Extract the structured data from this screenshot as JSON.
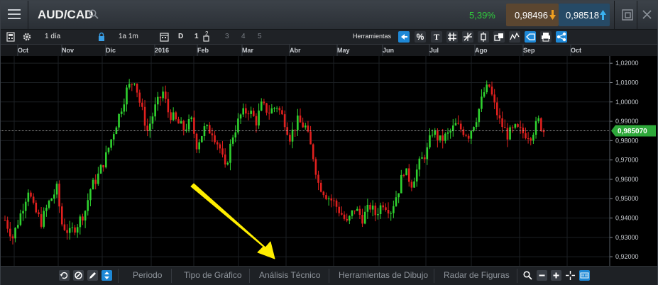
{
  "header": {
    "symbol": "AUD/CAD",
    "change": "5,39%",
    "bid": "0,98496",
    "ask": "0,98518",
    "icons": [
      "menu-icon",
      "search-icon",
      "arrow-down-icon",
      "arrow-up-icon",
      "detach-icon",
      "close-icon"
    ]
  },
  "toolbar": {
    "period": "1 día",
    "range": "1a 1m",
    "d_label": "D",
    "n1": "1",
    "n2": "2",
    "n3": "3",
    "n4": "4",
    "n5": "5",
    "tools_label": "Herramientas",
    "percent": "%"
  },
  "chart_data": {
    "type": "candlestick",
    "symbol": "AUD/CAD",
    "x_ticks": [
      "Oct",
      "Nov",
      "Dic",
      "2016",
      "Feb",
      "Mar",
      "Abr",
      "May",
      "Jun",
      "Jul",
      "Ago",
      "Sep",
      "Oct"
    ],
    "y_ticks": [
      "1,02000",
      "1,01000",
      "1,00000",
      "0,99000",
      "0,98000",
      "0,97000",
      "0,96000",
      "0,95000",
      "0,94000",
      "0,93000",
      "0,92000"
    ],
    "ylim": [
      0.916,
      1.023
    ],
    "current_price": 0.98507,
    "current_price_label": "0,985070",
    "close_path": [
      [
        0,
        0.939
      ],
      [
        3,
        0.93
      ],
      [
        6,
        0.942
      ],
      [
        9,
        0.955
      ],
      [
        11,
        0.945
      ],
      [
        14,
        0.938
      ],
      [
        17,
        0.948
      ],
      [
        20,
        0.955
      ],
      [
        22,
        0.937
      ],
      [
        25,
        0.932
      ],
      [
        28,
        0.937
      ],
      [
        31,
        0.944
      ],
      [
        33,
        0.955
      ],
      [
        36,
        0.962
      ],
      [
        39,
        0.972
      ],
      [
        42,
        0.985
      ],
      [
        44,
        0.993
      ],
      [
        47,
        1.006
      ],
      [
        50,
        1.012
      ],
      [
        52,
        1.0
      ],
      [
        55,
        0.985
      ],
      [
        58,
        0.997
      ],
      [
        61,
        1.005
      ],
      [
        63,
        0.995
      ],
      [
        66,
        0.99
      ],
      [
        69,
        0.986
      ],
      [
        72,
        0.99
      ],
      [
        74,
        0.978
      ],
      [
        77,
        0.986
      ],
      [
        80,
        0.985
      ],
      [
        83,
        0.976
      ],
      [
        85,
        0.965
      ],
      [
        88,
        0.983
      ],
      [
        91,
        0.993
      ],
      [
        94,
        0.996
      ],
      [
        97,
        0.99
      ],
      [
        99,
        0.998
      ],
      [
        102,
        0.995
      ],
      [
        105,
        0.998
      ],
      [
        108,
        0.99
      ],
      [
        110,
        0.982
      ],
      [
        113,
        0.99
      ],
      [
        116,
        0.987
      ],
      [
        119,
        0.972
      ],
      [
        121,
        0.958
      ],
      [
        124,
        0.952
      ],
      [
        127,
        0.948
      ],
      [
        130,
        0.942
      ],
      [
        132,
        0.937
      ],
      [
        135,
        0.945
      ],
      [
        138,
        0.94
      ],
      [
        141,
        0.946
      ],
      [
        143,
        0.942
      ],
      [
        146,
        0.948
      ],
      [
        149,
        0.944
      ],
      [
        152,
        0.955
      ],
      [
        154,
        0.965
      ],
      [
        157,
        0.958
      ],
      [
        160,
        0.968
      ],
      [
        163,
        0.975
      ],
      [
        165,
        0.985
      ],
      [
        168,
        0.98
      ],
      [
        171,
        0.983
      ],
      [
        174,
        0.988
      ],
      [
        176,
        0.986
      ],
      [
        179,
        0.983
      ],
      [
        182,
        0.992
      ],
      [
        185,
        1.005
      ],
      [
        187,
        1.008
      ],
      [
        189,
        0.998
      ],
      [
        191,
        0.99
      ],
      [
        194,
        0.983
      ],
      [
        197,
        0.986
      ],
      [
        200,
        0.984
      ],
      [
        203,
        0.983
      ],
      [
        206,
        0.99
      ],
      [
        208,
        0.985
      ]
    ]
  }
}
